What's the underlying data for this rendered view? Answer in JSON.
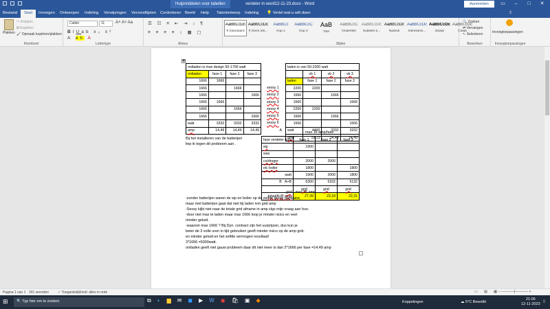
{
  "titlebar": {
    "context_tab": "Hulpmiddelen voor tabellen",
    "doc_title": "verdeler in word12-11-23.docx - Word",
    "login": "Aanmelden",
    "min": "–",
    "max": "□",
    "close": "✕"
  },
  "tabs": [
    "Bestand",
    "Start",
    "Invoegen",
    "Ontwerpen",
    "Indeling",
    "Verwijzingen",
    "Verzendlijsten",
    "Controleren",
    "Beeld",
    "Help",
    "Tabelontwerp",
    "Indeling"
  ],
  "tell": "Vertel wat u wilt doen",
  "ribbon": {
    "clipboard": {
      "paste": "Plakken",
      "cut": "Knippen",
      "copy": "Kopiëren",
      "painter": "Opmaak kopiëren/plakken",
      "label": "Klembord"
    },
    "font": {
      "name": "Calibri",
      "size": "11",
      "label": "Lettertype"
    },
    "paragraph": {
      "label": "Alinea"
    },
    "styles": {
      "label": "Stijlen",
      "items": [
        {
          "preview": "AaBbCcDc",
          "name": "¶ Standaard"
        },
        {
          "preview": "AaBbCcDc",
          "name": "¶ Geen afs..."
        },
        {
          "preview": "AaBbCc",
          "name": "Kop 1"
        },
        {
          "preview": "AaBbCcC",
          "name": "Kop 2"
        },
        {
          "preview": "AaB",
          "name": "Titel"
        },
        {
          "preview": "AaBbCcC",
          "name": "Ondertitel"
        },
        {
          "preview": "AaBbCcDc",
          "name": "Subtiele b..."
        },
        {
          "preview": "AaBbCcDc",
          "name": "Nadruk"
        },
        {
          "preview": "AaBbCcDc",
          "name": "Intensieve..."
        },
        {
          "preview": "AaBbCcDc",
          "name": "Zwaar"
        },
        {
          "preview": "AaBbCcDc",
          "name": "Citaat"
        }
      ]
    },
    "editing": {
      "find": "Zoeken",
      "replace": "Vervangen",
      "select": "Selecteren",
      "label": "Bewerken"
    },
    "addins": {
      "name": "Invoegtoepassingen",
      "label": "Invoegtoepassingen"
    }
  },
  "doc": {
    "t1": {
      "title": "ontladen is max design 50-1700 watt",
      "header": [
        "ontladen",
        "fase 1",
        "fase 2",
        "fase 3"
      ],
      "rows": [
        [
          "1666",
          "1666",
          "",
          ""
        ],
        [
          "1666",
          "",
          "1666",
          ""
        ],
        [
          "1666",
          "",
          "",
          "1666"
        ],
        [
          "1666",
          "1666",
          "",
          ""
        ],
        [
          "1666",
          "",
          "1666",
          ""
        ],
        [
          "1666",
          "",
          "",
          "1666"
        ]
      ],
      "watt": [
        "watt",
        "3332",
        "3332",
        "3332"
      ],
      "amp": [
        "amp",
        "14,49",
        "14,49",
        "14,49"
      ]
    },
    "t2": {
      "title": "laden is van 50-2200 watt",
      "header_top": [
        "vb 1",
        "vb 2",
        "vb 3"
      ],
      "header": [
        "laden",
        "fase 1",
        "fase 2",
        "fase 3"
      ],
      "sessy": [
        "sessy 1",
        "sessy 2",
        "sessy 3",
        "sessy 4",
        "sessy 5",
        "sessy 6"
      ],
      "rows": [
        [
          "2200",
          "2200",
          "",
          ""
        ],
        [
          "1666",
          "",
          "1666",
          ""
        ],
        [
          "1666",
          "",
          "",
          "1666"
        ],
        [
          "2200",
          "2200",
          "",
          ""
        ],
        [
          "1666",
          "",
          "1666",
          ""
        ],
        [
          "1666",
          "",
          "",
          "1666"
        ]
      ],
      "a_label": "A",
      "watt": [
        "watt",
        "4400",
        "3332",
        "3332"
      ],
      "amp": [
        "amp",
        "19,13",
        "14,49",
        "14,49"
      ]
    },
    "t3": {
      "max16": "max 16 amp/fase",
      "header": [
        "fase verdeler huis",
        "fase 1",
        "fase 2",
        "fase 3"
      ],
      "rows": [
        [
          "wp",
          "1900",
          "1900",
          "",
          ""
        ],
        [
          "was",
          "",
          "",
          "",
          ""
        ],
        [
          "co/droger",
          "2000",
          "",
          "2000",
          ""
        ],
        [
          "elc boiler",
          "1800",
          "",
          "",
          "1800"
        ]
      ],
      "watt": [
        "watt",
        "1900",
        "2000",
        "1800"
      ],
      "b_label": "B",
      "ab": [
        "A+B",
        "6300",
        "5332",
        "5132"
      ],
      "grid": [
        "grid",
        "grid",
        "grid"
      ],
      "total_label": "totaalA+B",
      "total": [
        "amp",
        "27,39",
        "23,18",
        "22,31"
      ],
      "grid2": "grid",
      "max25": "max 25 amp"
    },
    "side_text": [
      "Bij het installeren van de batterijen",
      "liep ik tegen dit probleem aan ."
    ],
    "body": [
      "-zonder batterijen waren de wp en boiler op de zelfde groep geplaatst,",
      "maar met batterijen gaat dat niet bij laden ivm grid amp",
      "-Sessy kijkt niet naar de totale grid afname in amp.vlgs mijn vraag aan hun.",
      "-door niet max te laden maar max 1666 loop je minder risico en veel",
      "minder geluid.",
      "-waarom max 1666 ? Bij Dyn. contract zijn het uurprijzen, dus kun je",
      "beter de 3 volle uren in tijd gebruiken geeft minder risico op de amp grid.",
      "en minder geluid en het zelfde vermogen resultaat!",
      "3*1666 =5000watt.",
      "ontladen geeft niet gauw probleem daar dit niet meer is dan 2*1666 per fase =14,49 amp"
    ]
  },
  "status": {
    "page": "Pagina 1 van 1",
    "words": "241 woorden",
    "access": "Toegankelijkheid: alles in orde"
  },
  "taskbar": {
    "search": "Typ hier om te zoeken",
    "coupling": "Koppelingen",
    "weather": "5°C  Bewolkt",
    "time": "21:06",
    "date": "12-11-2023"
  },
  "colors": {
    "ribbon_blue": "#2b579a",
    "highlight": "#ffff00"
  }
}
